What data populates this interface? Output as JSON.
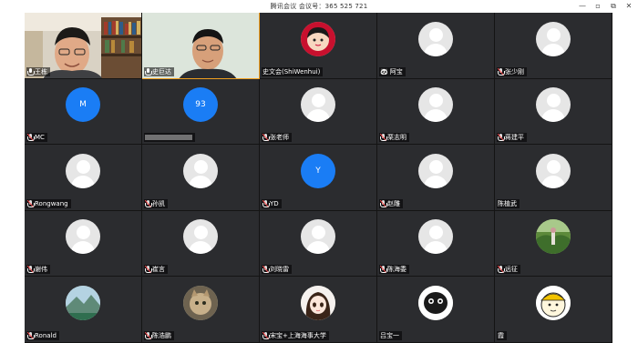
{
  "window": {
    "title": "腾讯会议 会议号：365 525 721",
    "controls": [
      "—",
      "▫",
      "⧉",
      "✕"
    ]
  },
  "participants": [
    {
      "name": "王栋",
      "type": "video1",
      "mic": "on"
    },
    {
      "name": "史巨达",
      "type": "video2",
      "mic": "on"
    },
    {
      "name": "史文会(ShiWenhui)",
      "type": "cartoon",
      "mic": "none"
    },
    {
      "name": "阿宝",
      "type": "generic",
      "mic": "emoji"
    },
    {
      "name": "张少刚",
      "type": "generic",
      "mic": "muted"
    },
    {
      "name": "MC",
      "type": "letter",
      "letter": "M",
      "mic": "muted"
    },
    {
      "name": "",
      "type": "letter",
      "letter": "93",
      "mic": "none",
      "blurred": true
    },
    {
      "name": "张老师",
      "type": "generic",
      "mic": "muted"
    },
    {
      "name": "栗志明",
      "type": "generic",
      "mic": "muted"
    },
    {
      "name": "蒋建平",
      "type": "generic",
      "mic": "muted"
    },
    {
      "name": "Rongwang",
      "type": "generic",
      "mic": "muted"
    },
    {
      "name": "孙凯",
      "type": "generic",
      "mic": "muted"
    },
    {
      "name": "YD",
      "type": "letter",
      "letter": "Y",
      "mic": "muted"
    },
    {
      "name": "赵雕",
      "type": "generic",
      "mic": "muted"
    },
    {
      "name": "陈植武",
      "type": "generic",
      "mic": "none"
    },
    {
      "name": "谢伟",
      "type": "generic",
      "mic": "muted"
    },
    {
      "name": "崔言",
      "type": "generic",
      "mic": "muted"
    },
    {
      "name": "刘晓雷",
      "type": "generic",
      "mic": "muted"
    },
    {
      "name": "陈海委",
      "type": "generic",
      "mic": "muted"
    },
    {
      "name": "远征",
      "type": "photo-forest",
      "mic": "muted"
    },
    {
      "name": "Ronald",
      "type": "photo-landscape",
      "mic": "muted"
    },
    {
      "name": "陈浩鹏",
      "type": "photo-cat",
      "mic": "muted"
    },
    {
      "name": "宋宝+上海海事大学",
      "type": "anime-girl",
      "mic": "muted"
    },
    {
      "name": "吕宝一",
      "type": "photo-bw",
      "mic": "none"
    },
    {
      "name": "霞",
      "type": "cartoon-yellow",
      "mic": "none"
    }
  ],
  "colors": {
    "tile_bg": "#2b2c2f",
    "letter_avatar": "#1a7df5",
    "speaking_border": "#f0a020"
  }
}
